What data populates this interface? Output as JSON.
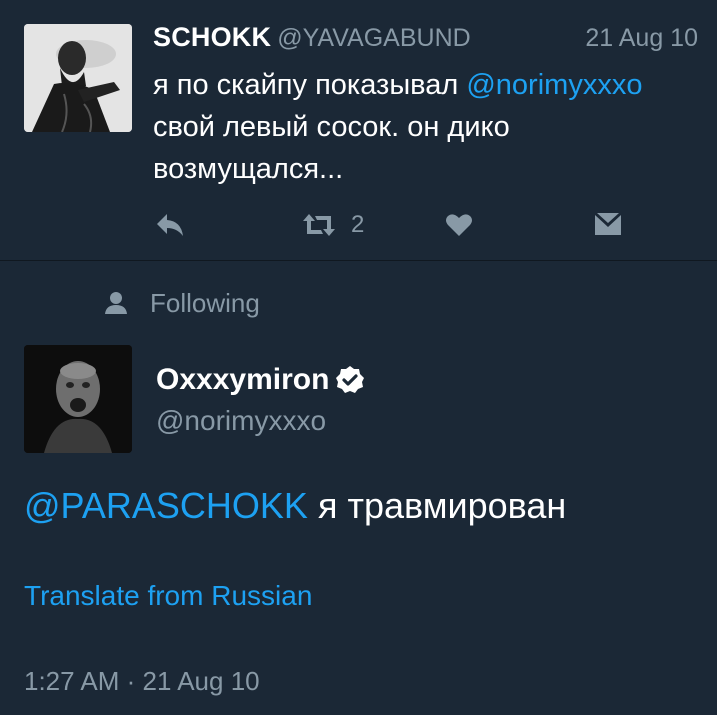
{
  "tweet1": {
    "author_name": "SCHOKK",
    "handle": "@YAVAGABUND",
    "date": "21 Aug 10",
    "text_part1": "я по скайпу показывал ",
    "mention": "@norimyxxxo",
    "text_part2": " свой левый сосок. он дико возмущался...",
    "retweet_count": "2",
    "avatar_icon": "person-photo-icon"
  },
  "tweet2": {
    "social_context": "Following",
    "author_name": "Oxxxymiron",
    "handle": "@norimyxxxo",
    "mention": "@PARASCHOKK",
    "text": " я травмирован",
    "translate_label": "Translate from Russian",
    "timestamp": "1:27 AM · 21 Aug 10",
    "verified_icon": "verified-badge-icon"
  },
  "colors": {
    "background": "#1b2836",
    "link": "#1da1f2",
    "secondary_text": "#8899a6",
    "primary_text": "#ffffff"
  }
}
